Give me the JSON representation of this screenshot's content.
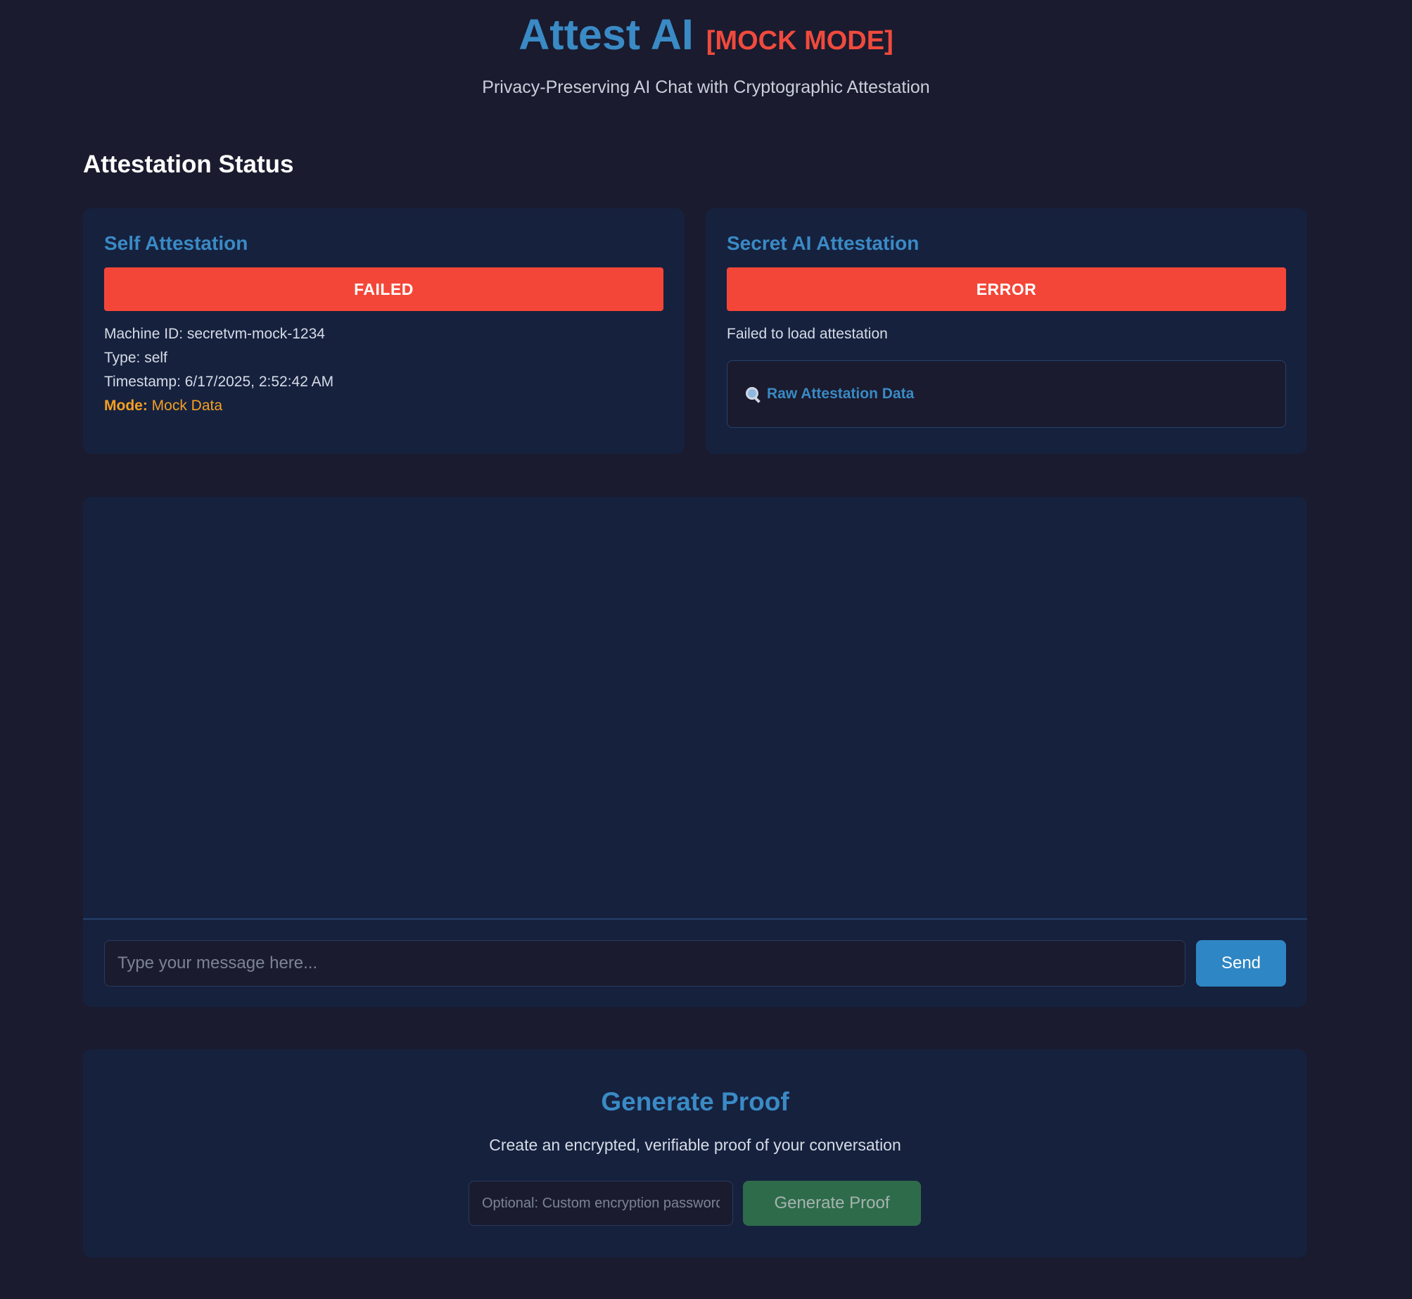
{
  "header": {
    "title": "Attest AI",
    "mode_badge": "[MOCK MODE]",
    "subtitle": "Privacy-Preserving AI Chat with Cryptographic Attestation"
  },
  "attestation": {
    "section_title": "Attestation Status",
    "self": {
      "title": "Self Attestation",
      "status": "FAILED",
      "machine_id": "Machine ID: secretvm-mock-1234",
      "type": "Type: self",
      "timestamp": "Timestamp: 6/17/2025, 2:52:42 AM",
      "mode_label": "Mode:",
      "mode_value": "Mock Data"
    },
    "secret_ai": {
      "title": "Secret AI Attestation",
      "status": "ERROR",
      "message": "Failed to load attestation",
      "raw_data_label": "Raw Attestation Data",
      "raw_data_icon": "magnifier-icon"
    }
  },
  "chat": {
    "input_placeholder": "Type your message here...",
    "send_label": "Send"
  },
  "proof": {
    "title": "Generate Proof",
    "description": "Create an encrypted, verifiable proof of your conversation",
    "password_placeholder": "Optional: Custom encryption password",
    "button_label": "Generate Proof"
  },
  "colors": {
    "background": "#1a1b2e",
    "card": "#16213e",
    "accent": "#3a8ac5",
    "error": "#f44638",
    "warning": "#f5a021",
    "proof_button": "#2e6b4a"
  }
}
